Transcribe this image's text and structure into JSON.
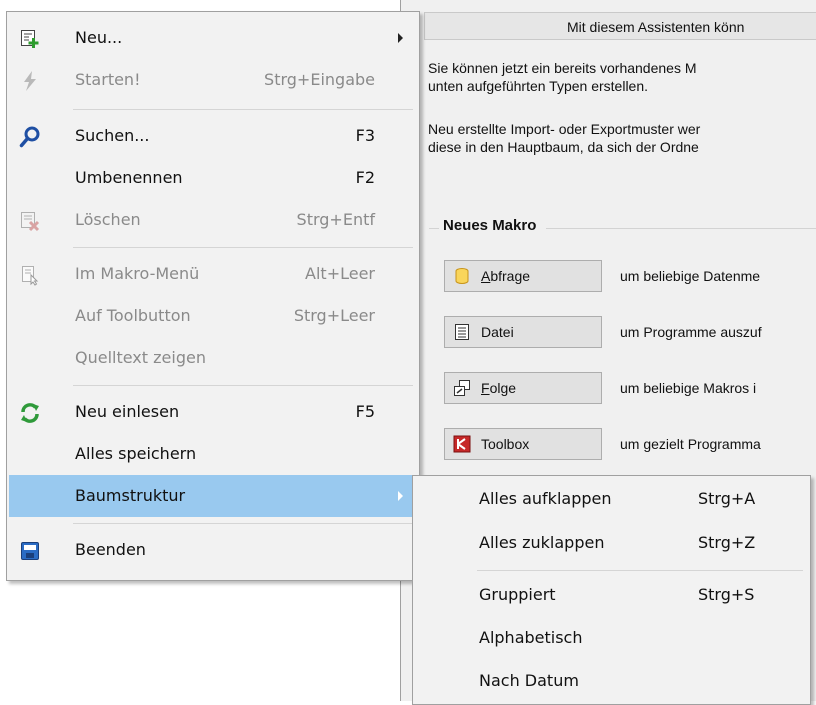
{
  "assistant": {
    "header_text": "Mit diesem Assistenten könn",
    "para1": [
      "Sie können jetzt ein bereits vorhandenes M",
      "unten aufgeführten Typen erstellen."
    ],
    "para2": [
      "Neu erstellte Import- oder Exportmuster wer",
      "diese in den Hauptbaum, da sich der Ordne"
    ],
    "group_title": "Neues Makro",
    "buttons": [
      {
        "label": "Abfrage",
        "desc": "um beliebige Datenme",
        "icon": "database-icon"
      },
      {
        "label": "Datei",
        "desc": "um Programme auszuf",
        "icon": "document-icon"
      },
      {
        "label": "Folge",
        "desc": "um beliebige Makros i",
        "icon": "sequence-icon"
      },
      {
        "label": "Toolbox",
        "desc": "um gezielt Programma",
        "icon": "toolbox-icon"
      }
    ]
  },
  "menu": {
    "items": [
      {
        "label": "Neu...",
        "shortcut": "",
        "icon": "new-icon"
      },
      {
        "label": "Starten!",
        "shortcut": "Strg+Eingabe",
        "icon": "lightning-icon"
      },
      {
        "label": "Suchen...",
        "shortcut": "F3",
        "icon": "search-icon"
      },
      {
        "label": "Umbenennen",
        "shortcut": "F2"
      },
      {
        "label": "Löschen",
        "shortcut": "Strg+Entf",
        "icon": "delete-icon"
      },
      {
        "label": "Im Makro-Menü",
        "shortcut": "Alt+Leer",
        "icon": "macro-menu-icon"
      },
      {
        "label": "Auf Toolbutton",
        "shortcut": "Strg+Leer"
      },
      {
        "label": "Quelltext zeigen",
        "shortcut": ""
      },
      {
        "label": "Neu einlesen",
        "shortcut": "F5",
        "icon": "refresh-icon"
      },
      {
        "label": "Alles speichern",
        "shortcut": ""
      },
      {
        "label": "Baumstruktur",
        "shortcut": ""
      },
      {
        "label": "Beenden",
        "shortcut": "",
        "icon": "exit-icon"
      }
    ]
  },
  "submenu": {
    "items": [
      {
        "label": "Alles aufklappen",
        "shortcut": "Strg+A"
      },
      {
        "label": "Alles zuklappen",
        "shortcut": "Strg+Z"
      },
      {
        "label": "Gruppiert",
        "shortcut": "Strg+S"
      },
      {
        "label": "Alphabetisch",
        "shortcut": ""
      },
      {
        "label": "Nach Datum",
        "shortcut": ""
      }
    ]
  },
  "colors": {
    "highlight": "#99c9ef",
    "menu_bg": "#f2f2f2",
    "disabled_text": "#8a8a8a",
    "window_bg": "#f0f0f0"
  }
}
